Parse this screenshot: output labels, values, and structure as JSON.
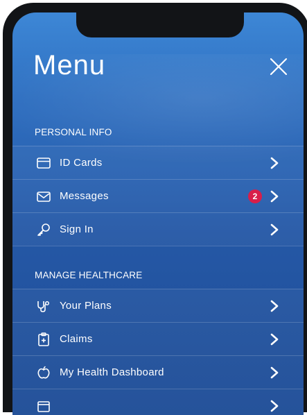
{
  "header": {
    "title": "Menu",
    "close_icon": "close-icon"
  },
  "sections": [
    {
      "title": "PERSONAL INFO",
      "items": [
        {
          "label": "ID Cards",
          "icon": "id-card-icon"
        },
        {
          "label": "Messages",
          "icon": "envelope-icon",
          "badge": "2"
        },
        {
          "label": "Sign In",
          "icon": "key-icon"
        }
      ]
    },
    {
      "title": "MANAGE HEALTHCARE",
      "items": [
        {
          "label": "Your Plans",
          "icon": "stethoscope-icon"
        },
        {
          "label": "Claims",
          "icon": "clipboard-icon"
        },
        {
          "label": "My Health Dashboard",
          "icon": "apple-icon"
        }
      ]
    }
  ],
  "colors": {
    "background_top": "#3d87d6",
    "background_bottom": "#1d4c96",
    "badge": "#d81e4a",
    "text": "#ffffff"
  }
}
